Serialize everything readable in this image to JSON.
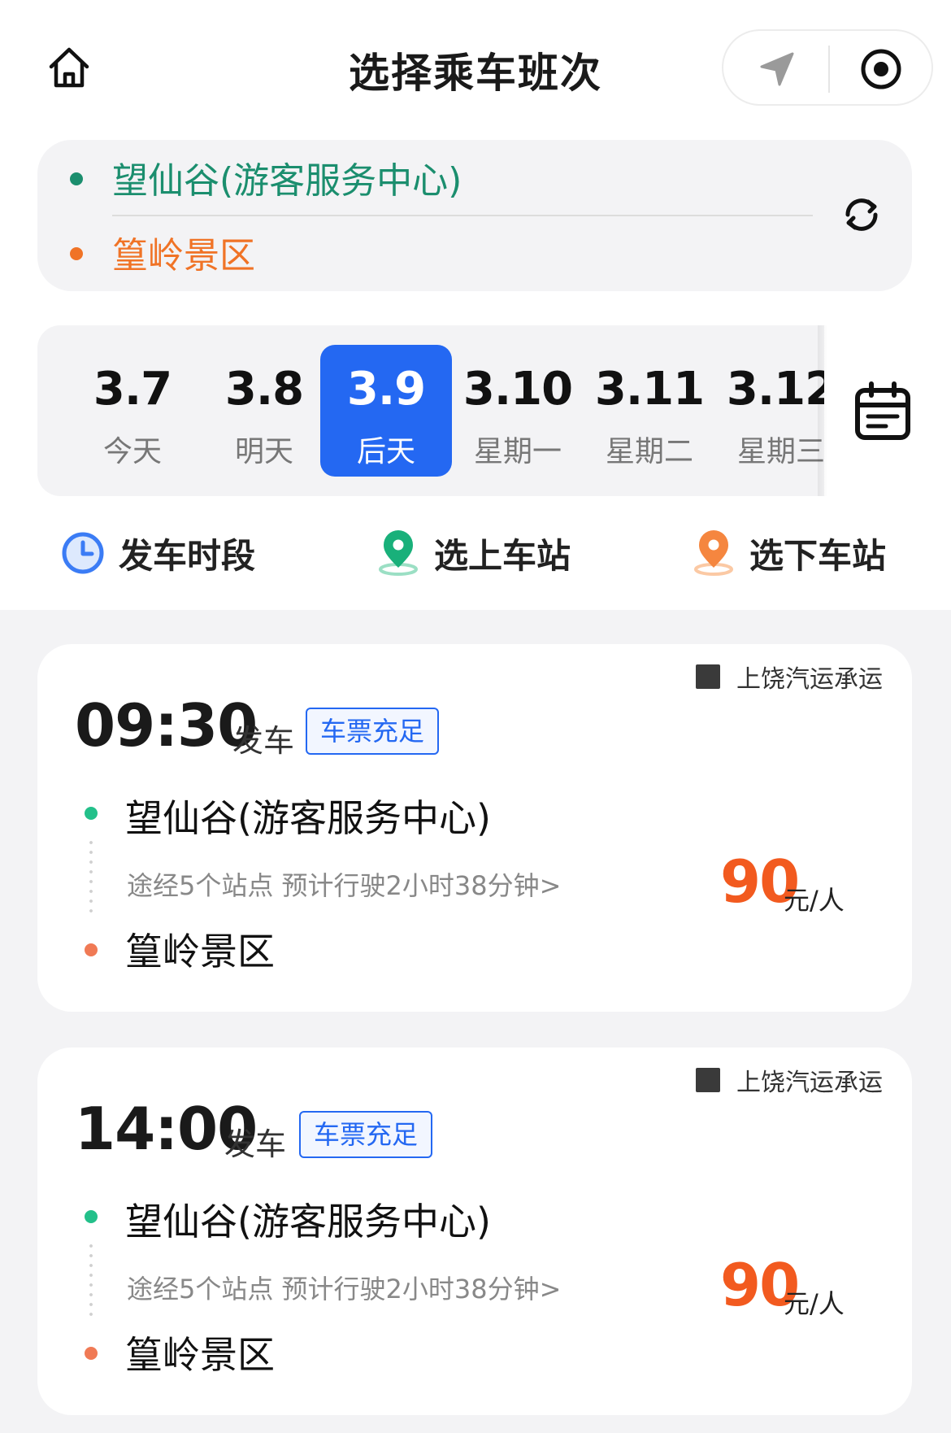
{
  "header": {
    "title": "选择乘车班次",
    "home_icon": "home-icon",
    "capsule": {
      "nav_icon": "navigation-arrow-icon",
      "target_icon": "target-icon"
    }
  },
  "route": {
    "from": "望仙谷(游客服务中心)",
    "to": "篁岭景区",
    "swap_icon": "swap-refresh-icon",
    "colors": {
      "from": "#1b8e6e",
      "to": "#f07326"
    }
  },
  "dates": [
    {
      "date": "3.7",
      "label": "今天",
      "active": false
    },
    {
      "date": "3.8",
      "label": "明天",
      "active": false
    },
    {
      "date": "3.9",
      "label": "后天",
      "active": true
    },
    {
      "date": "3.10",
      "label": "星期一",
      "active": false
    },
    {
      "date": "3.11",
      "label": "星期二",
      "active": false
    },
    {
      "date": "3.12",
      "label": "星期三",
      "active": false
    }
  ],
  "calendar_icon": "calendar-icon",
  "filters": [
    {
      "label": "发车时段",
      "icon": "clock-icon"
    },
    {
      "label": "选上车站",
      "icon": "pickup-location-icon"
    },
    {
      "label": "选下车站",
      "icon": "dropoff-location-icon"
    }
  ],
  "trips": [
    {
      "operator": "上饶汽运承运",
      "time": "09:30",
      "depart_label": "发车",
      "status": "车票充足",
      "from": "望仙谷(游客服务中心)",
      "via": "途经5个站点 预计行驶2小时38分钟>",
      "to": "篁岭景区",
      "price": "90",
      "unit": "元/人"
    },
    {
      "operator": "上饶汽运承运",
      "time": "14:00",
      "depart_label": "发车",
      "status": "车票充足",
      "from": "望仙谷(游客服务中心)",
      "via": "途经5个站点 预计行驶2小时38分钟>",
      "to": "篁岭景区",
      "price": "90",
      "unit": "元/人"
    }
  ],
  "colors": {
    "accent": "#2468f2",
    "price": "#f25a1f"
  }
}
